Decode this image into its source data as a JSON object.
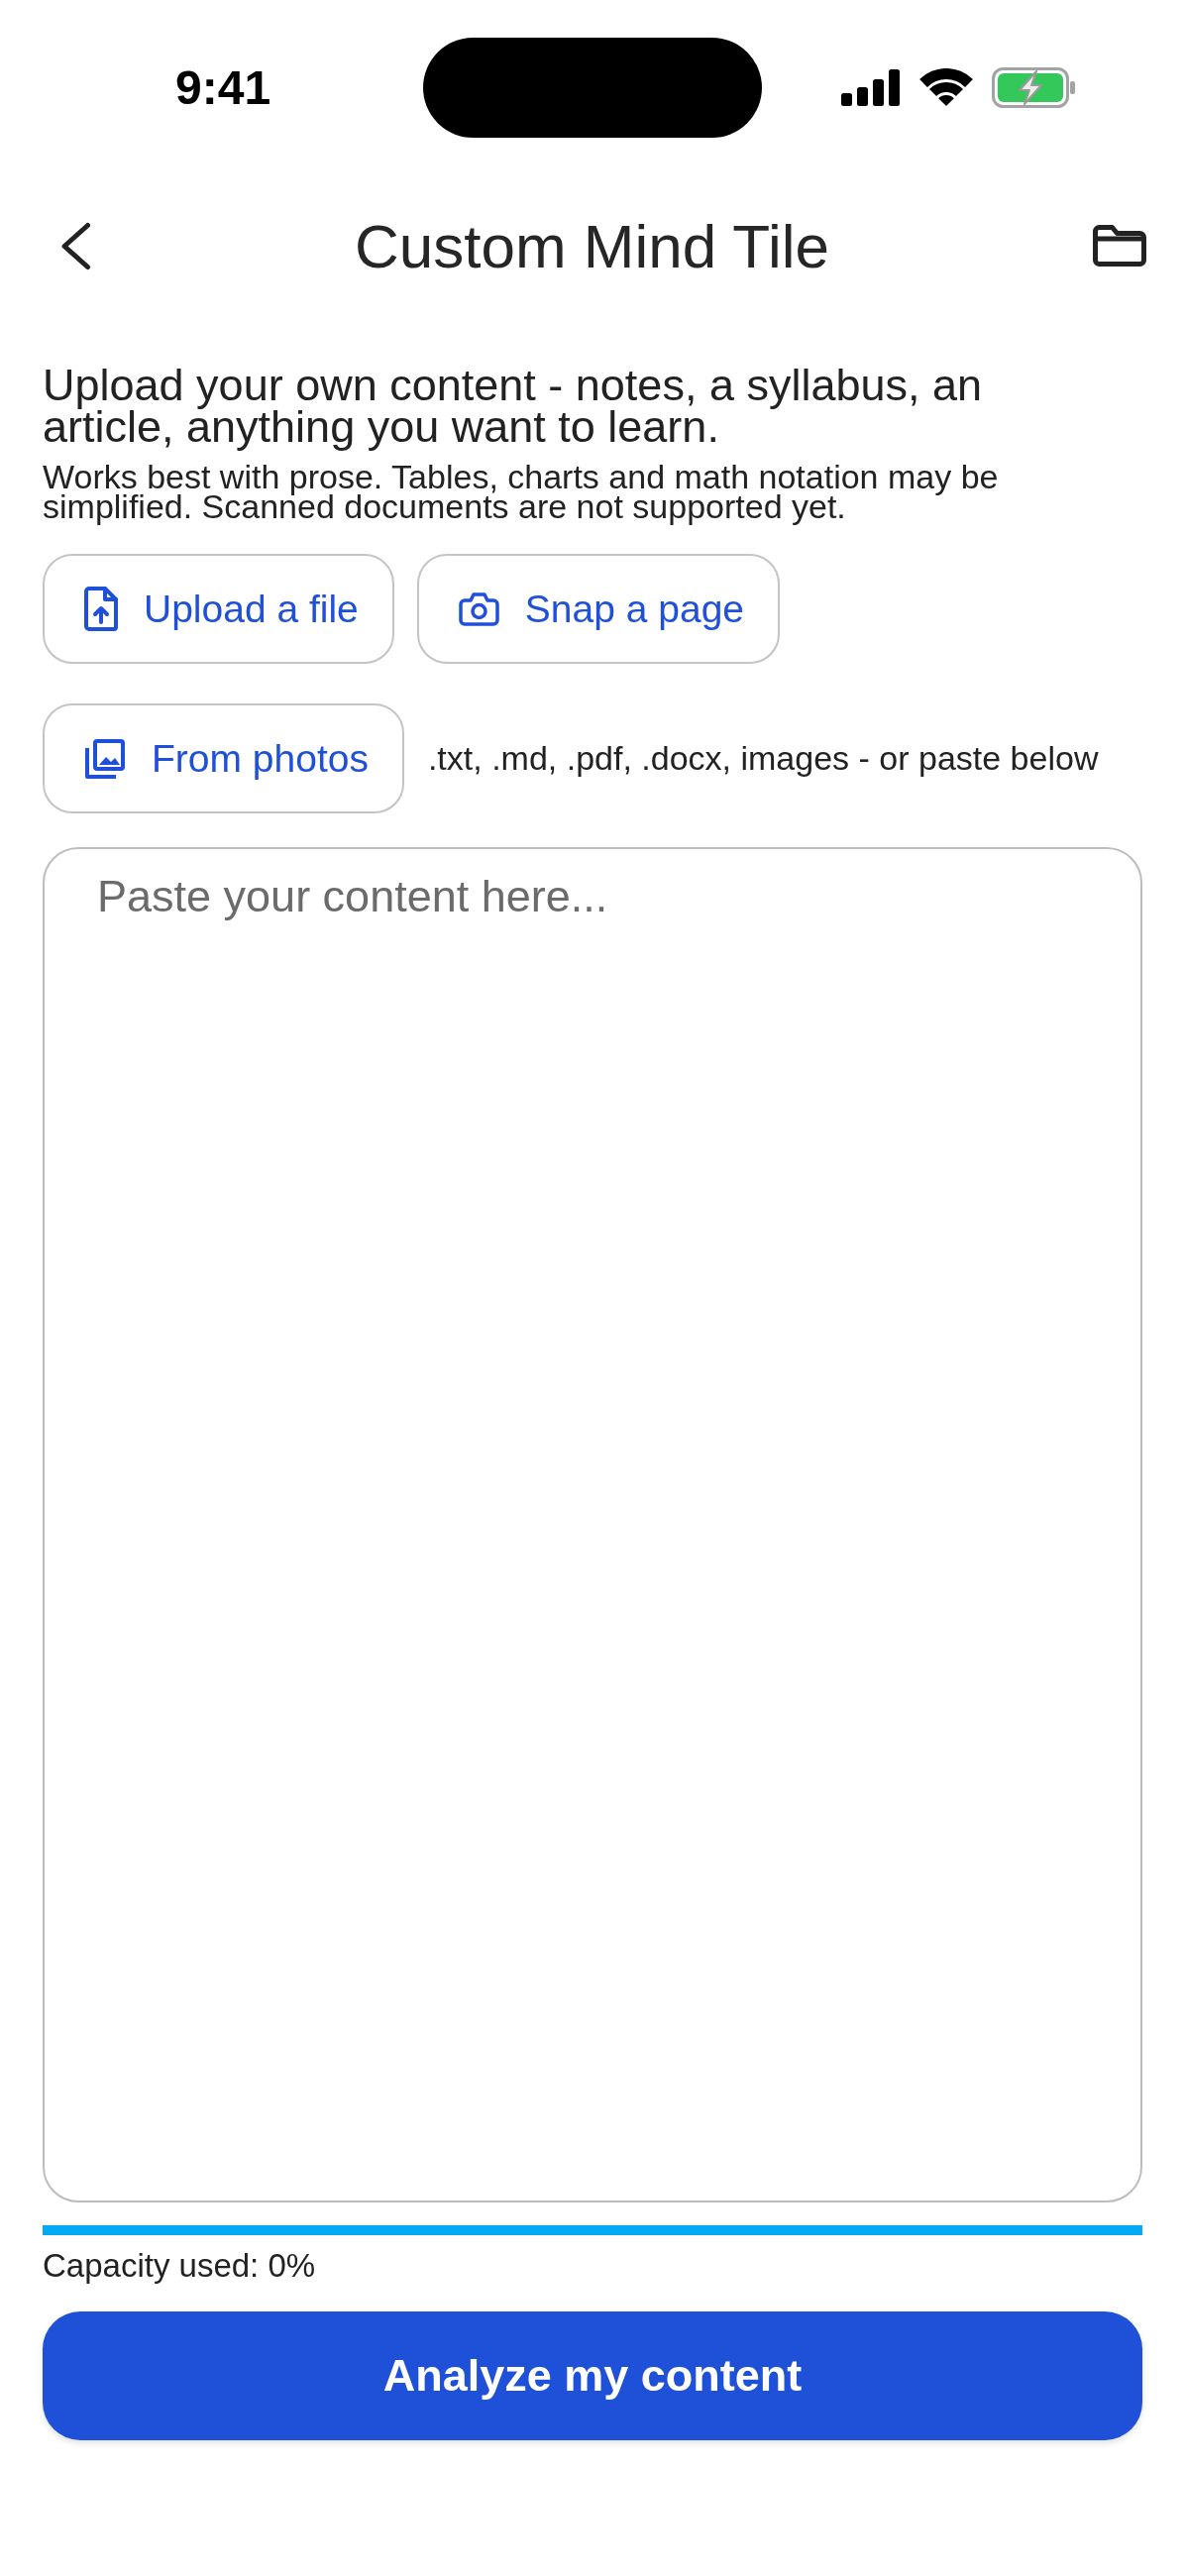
{
  "status_bar": {
    "time": "9:41"
  },
  "header": {
    "title": "Custom Mind Tile"
  },
  "intro": {
    "heading": "Upload your own content - notes, a syllabus, an article, anything you want to learn.",
    "note": "Works best with prose. Tables, charts and math notation may be simplified. Scanned documents are not supported yet."
  },
  "upload_buttons": [
    {
      "kind": "file",
      "label": "Upload a file"
    },
    {
      "kind": "camera",
      "label": "Snap a page"
    },
    {
      "kind": "photos",
      "label": "From photos"
    }
  ],
  "formats_hint": ".txt, .md, .pdf, .docx, images - or paste below",
  "content_field": {
    "placeholder": "Paste your content here..."
  },
  "capacity": {
    "level": 0,
    "label": "Capacity used: 0%"
  },
  "primary_button": {
    "label": "Analyze my content"
  }
}
